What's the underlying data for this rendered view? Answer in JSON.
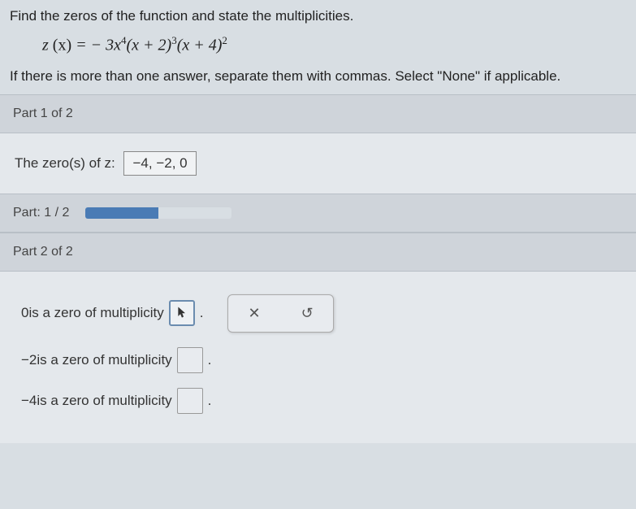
{
  "question": {
    "prompt": "Find the zeros of the function and state the multiplicities.",
    "instruction": "If there is more than one answer, separate them with commas. Select \"None\" if applicable."
  },
  "equation": {
    "lhs": "z",
    "var": "(x)",
    "rhs_prefix": " = − 3x",
    "exp1": "4",
    "factor2_open": "(x + 2)",
    "exp2": "3",
    "factor3_open": "(x + 4)",
    "exp3": "2"
  },
  "part1": {
    "header": "Part 1 of 2",
    "label": "The zero(s) of z: ",
    "answer": "−4, −2, 0"
  },
  "progress": {
    "label": "Part: 1 / 2"
  },
  "part2": {
    "header": "Part 2 of 2",
    "rows": [
      {
        "value": "0",
        "text": " is a zero of multiplicity "
      },
      {
        "value": "−2",
        "text": " is a zero of multiplicity "
      },
      {
        "value": "−4",
        "text": " is a zero of multiplicity "
      }
    ],
    "period": "."
  },
  "actions": {
    "clear": "✕",
    "reset": "↺"
  }
}
